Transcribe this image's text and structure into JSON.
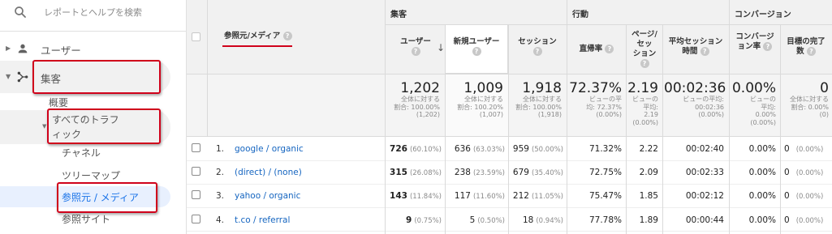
{
  "search": {
    "placeholder": "レポートとヘルプを検索"
  },
  "nav": {
    "users": "ユーザー",
    "acquisition": "集客",
    "overview": "概要",
    "all_traffic": "すべてのトラフィック",
    "all_traffic_line1": "すべてのトラフ",
    "all_traffic_line2": "ィック",
    "channels": "チャネル",
    "treemap": "ツリーマップ",
    "source_medium": "参照元 / メディア",
    "referrals": "参照サイト"
  },
  "table": {
    "dimension_header": "参照元/メディア",
    "groups": {
      "acquisition": "集客",
      "behavior": "行動",
      "conversions": "コンバージョン"
    },
    "columns": {
      "users": "ユーザー",
      "new_users": "新規ユーザー",
      "sessions": "セッション",
      "bounce_rate": "直帰率",
      "pages_per_session_l1": "ページ/",
      "pages_per_session_l2": "セッ",
      "pages_per_session_l3": "ション",
      "avg_session_l1": "平均セッション",
      "avg_session_l2": "時間",
      "conv_rate_l1": "コンバージ",
      "conv_rate_l2": "ョン率",
      "goal_l1": "目標の完了",
      "goal_l2": "数"
    },
    "totals": {
      "users": {
        "big": "1,202",
        "l1": "全体に対する",
        "l2": "割合: 100.00%",
        "l3": "(1,202)"
      },
      "new_users": {
        "big": "1,009",
        "l1": "全体に対する",
        "l2": "割合: 100.20%",
        "l3": "(1,007)"
      },
      "sessions": {
        "big": "1,918",
        "l1": "全体に対する",
        "l2": "割合: 100.00%",
        "l3": "(1,918)"
      },
      "bounce_rate": {
        "big": "72.37%",
        "l1": "ビューの平",
        "l2": "均: 72.37%",
        "l3": "(0.00%)"
      },
      "pages_per_session": {
        "big": "2.19",
        "l1": "ビューの",
        "l2": "平均:",
        "l3": "2.19",
        "l4": "(0.00%)"
      },
      "avg_session": {
        "big": "00:02:36",
        "l1": "ビューの平均:",
        "l2": "00:02:36",
        "l3": "(0.00%)"
      },
      "conv_rate": {
        "big": "0.00%",
        "l1": "ビューの",
        "l2": "平均:",
        "l3": "0.00%",
        "l4": "(0.00%)"
      },
      "goal": {
        "big": "0",
        "l1": "全体に対する",
        "l2": "割合: 0.00% (0)"
      }
    },
    "rows": [
      {
        "num": "1.",
        "name": "google / organic",
        "users": "726",
        "users_pct": "(60.10%)",
        "new_users": "636",
        "new_users_pct": "(63.03%)",
        "sessions": "959",
        "sessions_pct": "(50.00%)",
        "bounce": "71.32%",
        "pps": "2.22",
        "avg": "00:02:40",
        "conv": "0.00%",
        "goal": "0",
        "goal_pct": "(0.00%)"
      },
      {
        "num": "2.",
        "name": "(direct) / (none)",
        "users": "315",
        "users_pct": "(26.08%)",
        "new_users": "238",
        "new_users_pct": "(23.59%)",
        "sessions": "679",
        "sessions_pct": "(35.40%)",
        "bounce": "72.75%",
        "pps": "2.09",
        "avg": "00:02:33",
        "conv": "0.00%",
        "goal": "0",
        "goal_pct": "(0.00%)"
      },
      {
        "num": "3.",
        "name": "yahoo / organic",
        "users": "143",
        "users_pct": "(11.84%)",
        "new_users": "117",
        "new_users_pct": "(11.60%)",
        "sessions": "212",
        "sessions_pct": "(11.05%)",
        "bounce": "75.47%",
        "pps": "1.85",
        "avg": "00:02:12",
        "conv": "0.00%",
        "goal": "0",
        "goal_pct": "(0.00%)"
      },
      {
        "num": "4.",
        "name": "t.co / referral",
        "users": "9",
        "users_pct": "(0.75%)",
        "new_users": "5",
        "new_users_pct": "(0.50%)",
        "sessions": "18",
        "sessions_pct": "(0.94%)",
        "bounce": "77.78%",
        "pps": "1.89",
        "avg": "00:00:44",
        "conv": "0.00%",
        "goal": "0",
        "goal_pct": "(0.00%)"
      }
    ]
  },
  "colors": {
    "accent": "#1a73e8",
    "highlight": "#d0021b",
    "link": "#1565c0"
  }
}
